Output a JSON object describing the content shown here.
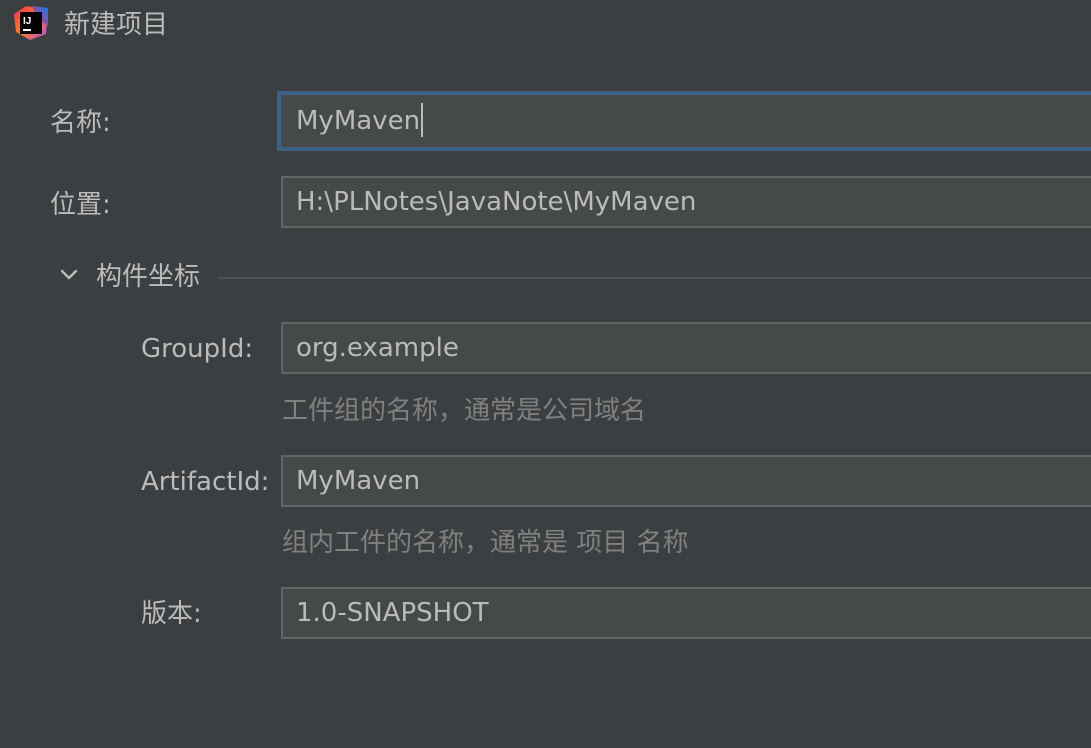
{
  "window": {
    "title": "新建项目",
    "app_icon": "intellij-idea-icon"
  },
  "form": {
    "name": {
      "label": "名称:",
      "value": "MyMaven"
    },
    "location": {
      "label": "位置:",
      "value": "H:\\PLNotes\\JavaNote\\MyMaven"
    }
  },
  "artifact_section": {
    "title": "构件坐标",
    "toggle_icon": "chevron-down-icon",
    "expanded": true,
    "group_id": {
      "label": "GroupId:",
      "value": "org.example",
      "hint": "工件组的名称，通常是公司域名"
    },
    "artifact_id": {
      "label": "ArtifactId:",
      "value": "MyMaven",
      "hint": "组内工件的名称，通常是 项目 名称"
    },
    "version": {
      "label": "版本:",
      "value": "1.0-SNAPSHOT"
    }
  },
  "colors": {
    "background": "#3c3f41",
    "field_background": "#45494a",
    "focus_border": "#3d6185",
    "text": "#bbbbbb",
    "hint_text": "#808080"
  }
}
